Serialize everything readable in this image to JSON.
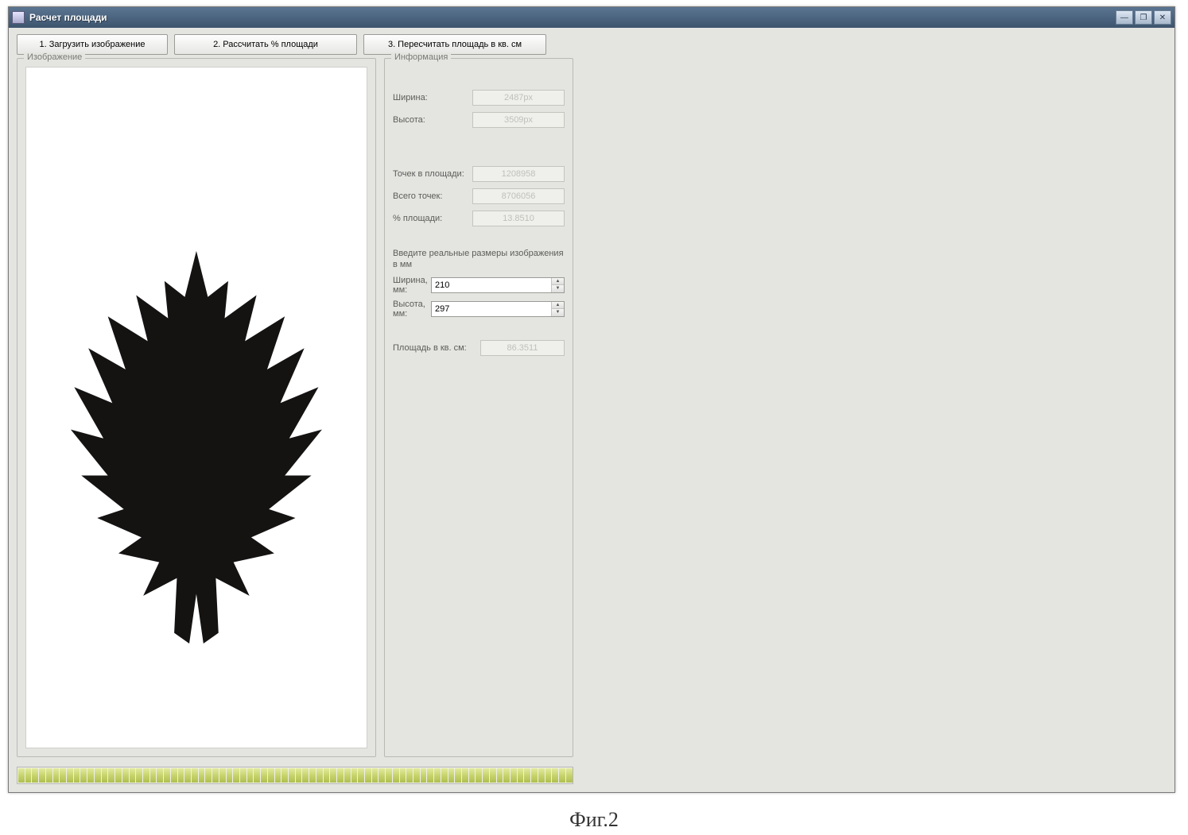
{
  "window": {
    "title": "Расчет площади"
  },
  "toolbar": {
    "load_label": "1. Загрузить изображение",
    "calc_label": "2. Рассчитать % площади",
    "recalc_label": "3. Пересчитать площадь в кв. см"
  },
  "image_panel": {
    "title": "Изображение"
  },
  "info_panel": {
    "title": "Информация",
    "width_label": "Ширина:",
    "width_value": "2487px",
    "height_label": "Высота:",
    "height_value": "3509px",
    "points_in_area_label": "Точек в площади:",
    "points_in_area_value": "1208958",
    "total_points_label": "Всего точек:",
    "total_points_value": "8706056",
    "percent_label": "% площади:",
    "percent_value": "13.8510",
    "real_size_section": "Введите реальные размеры изображения в мм",
    "width_mm_label": "Ширина, мм:",
    "width_mm_value": "210",
    "height_mm_label": "Высота, мм:",
    "height_mm_value": "297",
    "area_label": "Площадь в кв. см:",
    "area_value": "86.3511"
  },
  "figure_caption": "Фиг.2"
}
